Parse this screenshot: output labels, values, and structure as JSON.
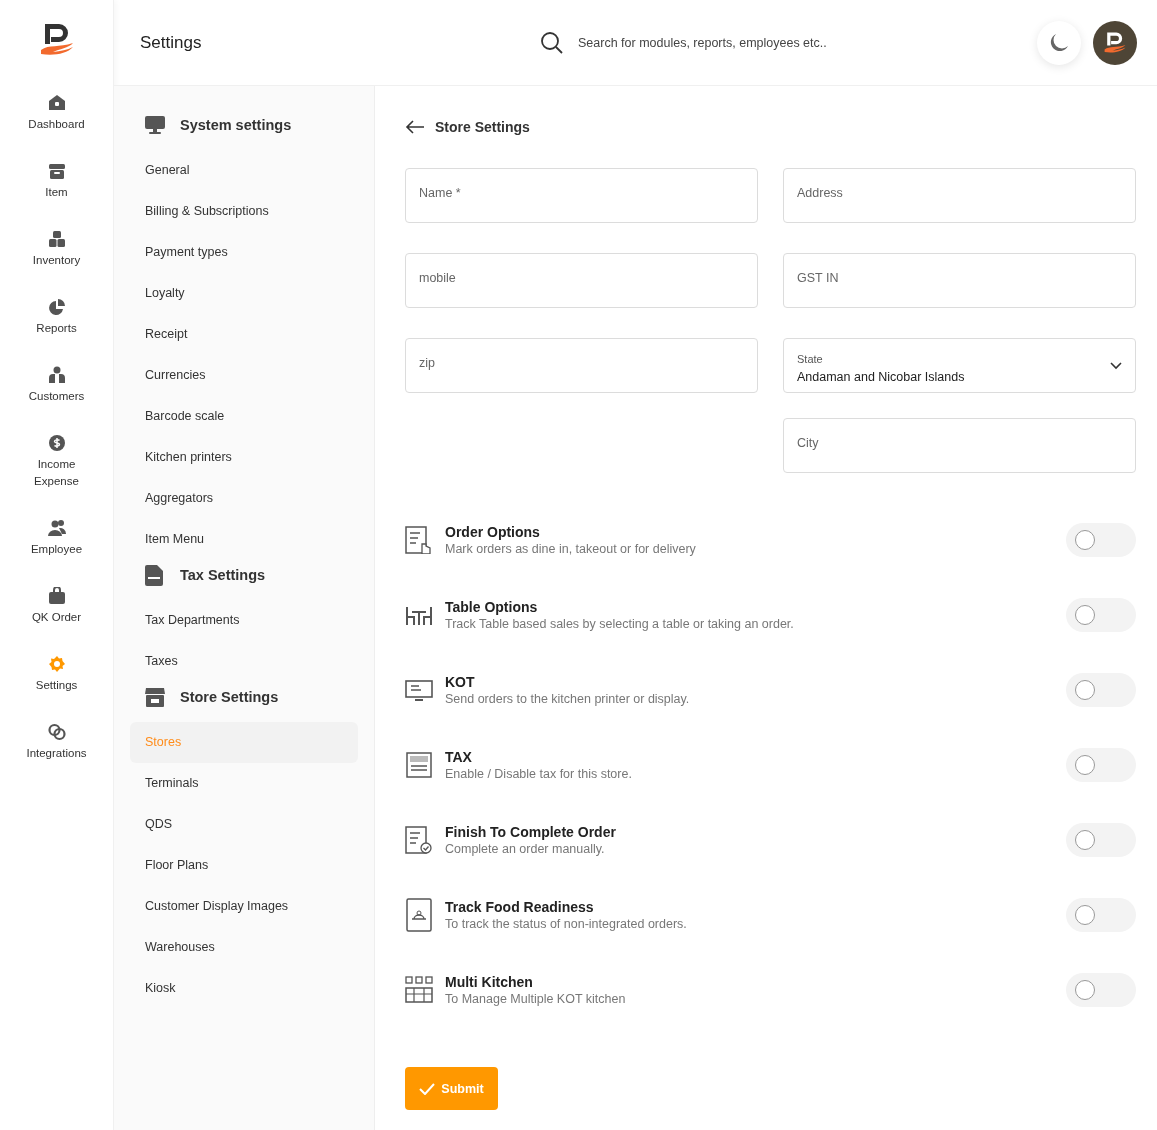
{
  "header": {
    "title": "Settings",
    "search": {
      "placeholder": "Search for modules, reports, employees etc.."
    }
  },
  "nav": [
    {
      "label": "Dashboard",
      "selected": false
    },
    {
      "label": "Item",
      "selected": false
    },
    {
      "label": "Inventory",
      "selected": false
    },
    {
      "label": "Reports",
      "selected": false
    },
    {
      "label": "Customers",
      "selected": false
    },
    {
      "label": "Income Expense",
      "selected": false
    },
    {
      "label": "Employee",
      "selected": false
    },
    {
      "label": "QK Order",
      "selected": false
    },
    {
      "label": "Settings",
      "selected": true
    },
    {
      "label": "Integrations",
      "selected": false
    }
  ],
  "settings_menu": [
    {
      "title": "System settings",
      "items": [
        {
          "label": "General",
          "selected": false
        },
        {
          "label": "Billing & Subscriptions",
          "selected": false
        },
        {
          "label": "Payment types",
          "selected": false
        },
        {
          "label": "Loyalty",
          "selected": false
        },
        {
          "label": "Receipt",
          "selected": false
        },
        {
          "label": "Currencies",
          "selected": false
        },
        {
          "label": "Barcode scale",
          "selected": false
        },
        {
          "label": "Kitchen printers",
          "selected": false
        },
        {
          "label": "Aggregators",
          "selected": false
        },
        {
          "label": "Item Menu",
          "selected": false
        }
      ]
    },
    {
      "title": "Tax Settings",
      "items": [
        {
          "label": "Tax Departments",
          "selected": false
        },
        {
          "label": "Taxes",
          "selected": false
        }
      ]
    },
    {
      "title": "Store Settings",
      "items": [
        {
          "label": "Stores",
          "selected": true
        },
        {
          "label": "Terminals",
          "selected": false
        },
        {
          "label": "QDS",
          "selected": false
        },
        {
          "label": "Floor Plans",
          "selected": false
        },
        {
          "label": "Customer Display Images",
          "selected": false
        },
        {
          "label": "Warehouses",
          "selected": false
        },
        {
          "label": "Kiosk",
          "selected": false
        }
      ]
    }
  ],
  "page_title": "Store Settings",
  "fields": [
    {
      "kind": "text",
      "placeholder": "Name *"
    },
    {
      "kind": "text",
      "placeholder": "Address"
    },
    {
      "kind": "text",
      "placeholder": "mobile"
    },
    {
      "kind": "text",
      "placeholder": "GST IN"
    },
    {
      "kind": "text",
      "placeholder": "zip"
    },
    {
      "kind": "select",
      "label": "State",
      "value": "Andaman and Nicobar Islands"
    },
    {
      "kind": "spacer"
    },
    {
      "kind": "text",
      "placeholder": "City"
    }
  ],
  "options": [
    {
      "title": "Order Options",
      "description": "Mark orders as dine in, takeout or for delivery",
      "on": false
    },
    {
      "title": "Table Options",
      "description": "Track Table based sales by selecting a table or taking an order.",
      "on": false
    },
    {
      "title": "KOT",
      "description": "Send orders to the kitchen printer or display.",
      "on": false
    },
    {
      "title": "TAX",
      "description": "Enable / Disable tax for this store.",
      "on": false
    },
    {
      "title": "Finish To Complete Order",
      "description": "Complete an order manually.",
      "on": false
    },
    {
      "title": "Track Food Readiness",
      "description": "To track the status of non-integrated orders.",
      "on": false
    },
    {
      "title": "Multi Kitchen",
      "description": "To Manage Multiple KOT kitchen",
      "on": false
    }
  ],
  "submit": "Submit"
}
